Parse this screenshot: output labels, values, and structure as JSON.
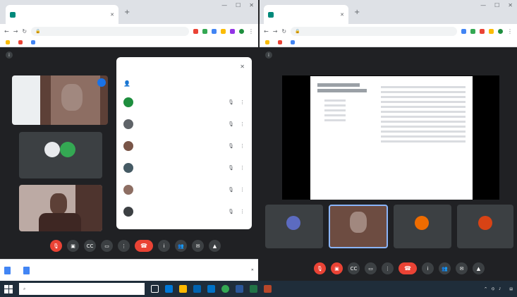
{
  "left_window": {
    "tab_title": "",
    "meeting_title": "",
    "participants_panel_title": "",
    "participants": [
      {
        "name": "",
        "color": "#1e8e3e"
      },
      {
        "name": "",
        "color": "#5f6368"
      },
      {
        "name": "",
        "color": "#795548"
      },
      {
        "name": "",
        "color": "#455a64"
      },
      {
        "name": "",
        "color": "#8d6e63"
      },
      {
        "name": "",
        "color": "#3c4043"
      }
    ],
    "tiles": [
      {
        "name": ""
      },
      {
        "name": ""
      },
      {
        "name": ""
      }
    ],
    "meeting_code": "",
    "downloads": [
      "",
      ""
    ],
    "downloads_show_all": ""
  },
  "right_window": {
    "tab_title": "",
    "meeting_title": "",
    "tiles": [
      {
        "name": ""
      },
      {
        "name": ""
      },
      {
        "name": ""
      },
      {
        "name": ""
      }
    ],
    "meeting_code": ""
  },
  "taskbar": {
    "search_placeholder": "",
    "time": "",
    "date": ""
  },
  "colors": {
    "end_call": "#ea4335",
    "chrome_tabstrip": "#dee1e6",
    "meet_bg": "#202124",
    "taskbar": "#1f2d3a"
  }
}
